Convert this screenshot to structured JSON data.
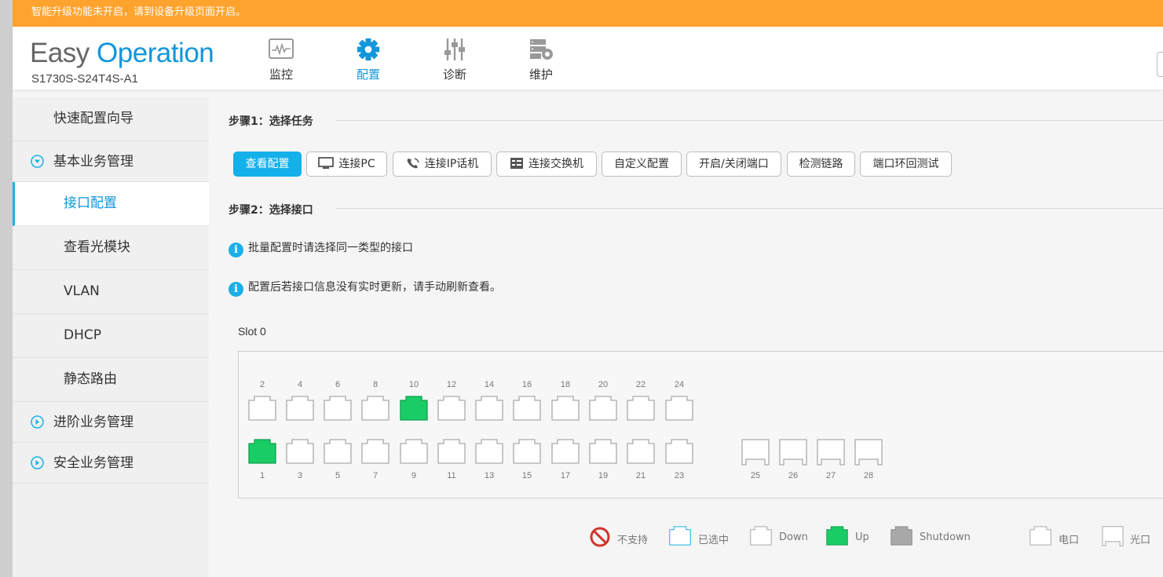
{
  "banner": {
    "text": "智能升级功能未开启，请到设备升级页面开启。"
  },
  "brand": {
    "part1": "Easy",
    "part2": "Operation",
    "model": "S1730S-S24T4S-A1"
  },
  "nav": [
    {
      "label": "监控",
      "icon": "monitor-icon"
    },
    {
      "label": "配置",
      "icon": "gear-icon",
      "active": true
    },
    {
      "label": "诊断",
      "icon": "sliders-icon"
    },
    {
      "label": "维护",
      "icon": "server-gear-icon"
    }
  ],
  "sidebar": {
    "items": [
      {
        "label": "快速配置向导"
      },
      {
        "label": "基本业务管理",
        "expanded": true
      },
      {
        "label": "接口配置",
        "active": true
      },
      {
        "label": "查看光模块"
      },
      {
        "label": "VLAN"
      },
      {
        "label": "DHCP"
      },
      {
        "label": "静态路由"
      },
      {
        "label": "进阶业务管理"
      },
      {
        "label": "安全业务管理"
      }
    ]
  },
  "step1": {
    "title": "步骤1：选择任务"
  },
  "tasks": [
    {
      "label": "查看配置",
      "active": true
    },
    {
      "label": "连接PC",
      "icon": "pc-icon"
    },
    {
      "label": "连接IP话机",
      "icon": "phone-icon"
    },
    {
      "label": "连接交换机",
      "icon": "switch-icon"
    },
    {
      "label": "自定义配置"
    },
    {
      "label": "开启/关闭端口"
    },
    {
      "label": "检测链路"
    },
    {
      "label": "端口环回测试"
    }
  ],
  "step2": {
    "title": "步骤2：选择接口"
  },
  "tips": [
    "批量配置时请选择同一类型的接口",
    "配置后若接口信息没有实时更新，请手动刷新查看。"
  ],
  "slot": {
    "label": "Slot 0",
    "top_row": [
      {
        "num": "2",
        "status": "down"
      },
      {
        "num": "4",
        "status": "down"
      },
      {
        "num": "6",
        "status": "down"
      },
      {
        "num": "8",
        "status": "down"
      },
      {
        "num": "10",
        "status": "up"
      },
      {
        "num": "12",
        "status": "down"
      },
      {
        "num": "14",
        "status": "down"
      },
      {
        "num": "16",
        "status": "down"
      },
      {
        "num": "18",
        "status": "down"
      },
      {
        "num": "20",
        "status": "down"
      },
      {
        "num": "22",
        "status": "down"
      },
      {
        "num": "24",
        "status": "down"
      }
    ],
    "bottom_row": [
      {
        "num": "1",
        "status": "up"
      },
      {
        "num": "3",
        "status": "down"
      },
      {
        "num": "5",
        "status": "down"
      },
      {
        "num": "7",
        "status": "down"
      },
      {
        "num": "9",
        "status": "down"
      },
      {
        "num": "11",
        "status": "down"
      },
      {
        "num": "13",
        "status": "down"
      },
      {
        "num": "15",
        "status": "down"
      },
      {
        "num": "17",
        "status": "down"
      },
      {
        "num": "19",
        "status": "down"
      },
      {
        "num": "21",
        "status": "down"
      },
      {
        "num": "23",
        "status": "down"
      }
    ],
    "optical": [
      {
        "num": "25",
        "status": "down"
      },
      {
        "num": "26",
        "status": "down"
      },
      {
        "num": "27",
        "status": "down"
      },
      {
        "num": "28",
        "status": "down"
      }
    ]
  },
  "legend": [
    {
      "label": "不支持",
      "kind": "unsupported"
    },
    {
      "label": "已选中",
      "kind": "selected"
    },
    {
      "label": "Down",
      "kind": "down"
    },
    {
      "label": "Up",
      "kind": "up"
    },
    {
      "label": "Shutdown",
      "kind": "shutdown"
    },
    {
      "label": "电口",
      "kind": "electric"
    },
    {
      "label": "光口",
      "kind": "optical"
    }
  ],
  "colors": {
    "accent": "#1296db",
    "banner": "#ffa32f",
    "up": "#19cc66",
    "shutdown": "#a8a8a8",
    "selected": "#1ab0e8"
  }
}
